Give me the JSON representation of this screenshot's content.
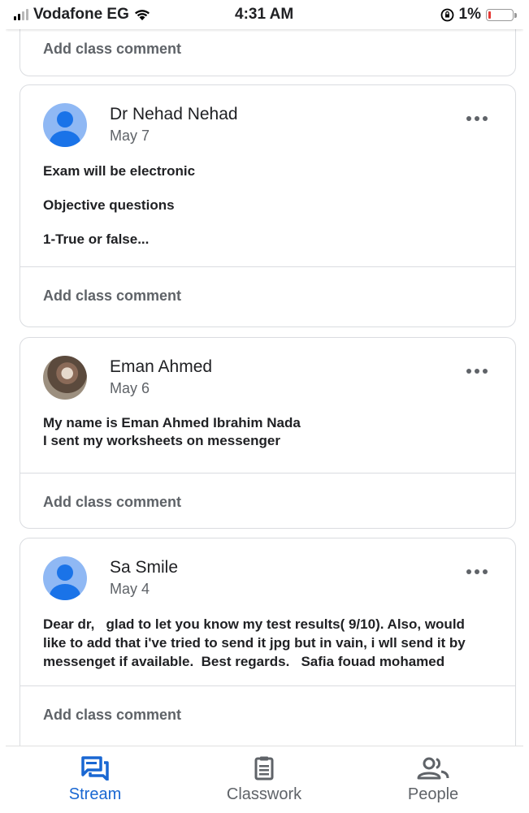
{
  "status": {
    "carrier": "Vodafone EG",
    "time": "4:31 AM",
    "battery_pct": "1%",
    "battery_level": 0.01,
    "accent_low_battery": "#e53935"
  },
  "top_card": {
    "comment_placeholder": "Add class comment"
  },
  "posts": [
    {
      "author": "Dr Nehad Nehad",
      "date": "May 7",
      "lines": [
        "Exam will be electronic",
        "Objective questions",
        "1-True or false..."
      ],
      "comment_placeholder": "Add class comment"
    },
    {
      "author": "Eman Ahmed",
      "date": "May 6",
      "lines": [
        "My name is Eman Ahmed Ibrahim Nada",
        "I sent my worksheets on messenger"
      ],
      "comment_placeholder": "Add class comment"
    },
    {
      "author": "Sa Smile",
      "date": "May 4",
      "lines": [
        "Dear dr,   glad to let you know my test results( 9/10). Also, would like to add that i've tried to send it jpg but in vain, i wll send it by messenget if available.  Best regards.   Safia fouad mohamed"
      ],
      "comment_placeholder": "Add class comment"
    }
  ],
  "nav": {
    "stream": "Stream",
    "classwork": "Classwork",
    "people": "People",
    "accent": "#1967d2"
  },
  "icons": {
    "stream": "stream-icon",
    "classwork": "classwork-icon",
    "people": "people-icon",
    "more": "more-horiz-icon"
  }
}
